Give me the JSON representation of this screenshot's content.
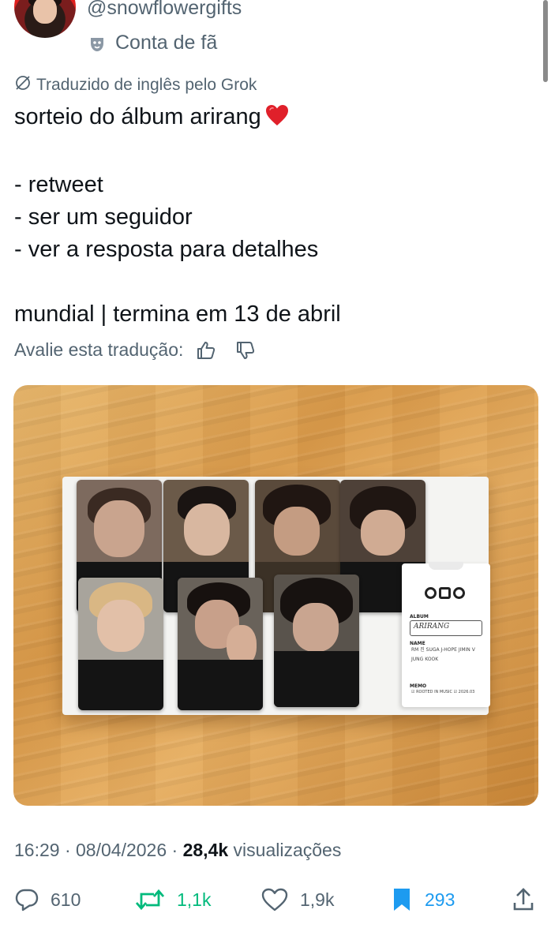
{
  "author": {
    "handle": "@snowflowergifts",
    "account_label": "Conta de fã"
  },
  "translation": {
    "notice": "Traduzido de inglês pelo Grok",
    "rate_label": "Avalie esta tradução:"
  },
  "tweet": {
    "line1": "sorteio do álbum arirang",
    "line2": "- retweet",
    "line3": "- ser um seguidor",
    "line4": "- ver a resposta para detalhes",
    "line5": "mundial | termina em 13 de abril"
  },
  "photo_card": {
    "album_label": "ALBUM",
    "album_value": "ARIRANG",
    "name_label": "NAME",
    "names": "RM  진  SUGA  J-HOPE  JIMIN  V  JUNG KOOK",
    "memo_label": "MEMO",
    "memo_text": "☑ ROOTED IN MUSIC   ☑ 2026.03"
  },
  "meta": {
    "time": "16:29",
    "date": "08/04/2026",
    "views_count": "28,4k",
    "views_label": "visualizações"
  },
  "actions": {
    "replies": "610",
    "retweets": "1,1k",
    "likes": "1,9k",
    "bookmarks": "293"
  },
  "colors": {
    "text": "#0f1419",
    "muted": "#536471",
    "retweet": "#00ba7c",
    "bookmark": "#1d9bf0",
    "heart_emoji": "#e0202a"
  },
  "icons": [
    "mask-icon",
    "grok-icon",
    "heart-emoji-icon",
    "thumbs-up-icon",
    "thumbs-down-icon",
    "reply-icon",
    "retweet-icon",
    "like-icon",
    "bookmark-icon",
    "share-icon"
  ]
}
